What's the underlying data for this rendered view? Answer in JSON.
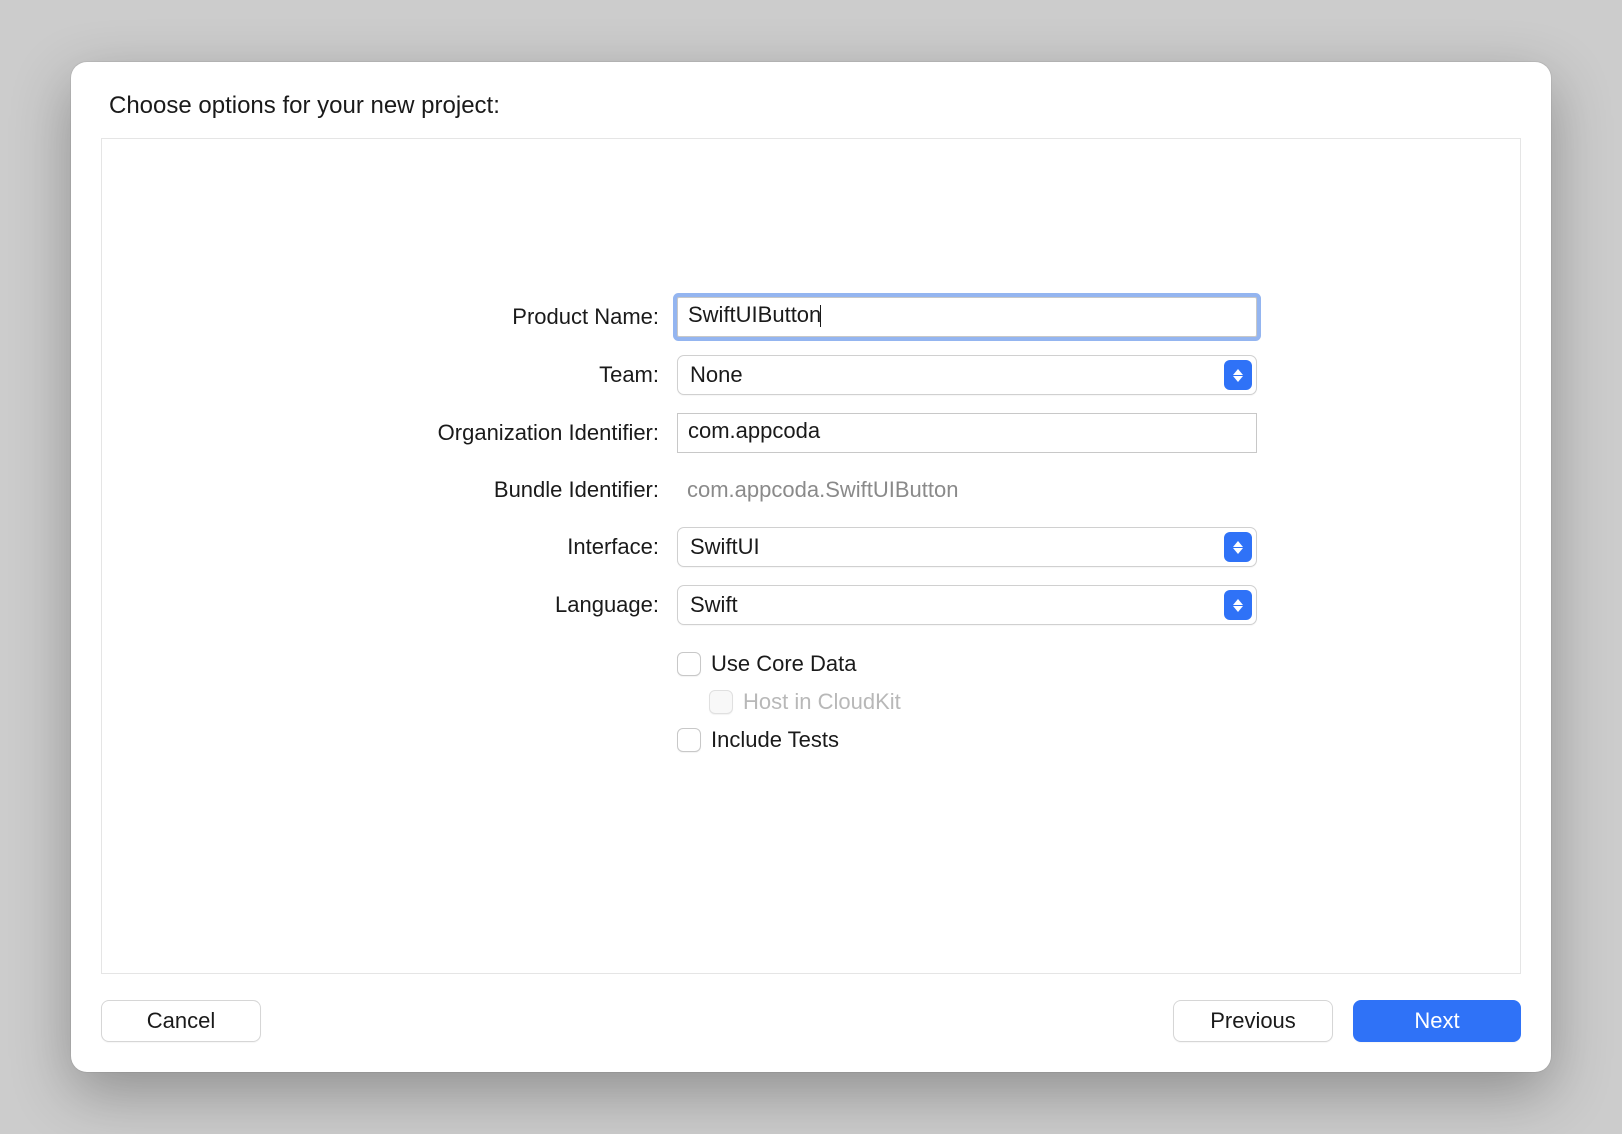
{
  "header": {
    "title": "Choose options for your new project:"
  },
  "form": {
    "productName": {
      "label": "Product Name:",
      "value": "SwiftUIButton"
    },
    "team": {
      "label": "Team:",
      "value": "None"
    },
    "orgIdentifier": {
      "label": "Organization Identifier:",
      "value": "com.appcoda"
    },
    "bundleIdentifier": {
      "label": "Bundle Identifier:",
      "value": "com.appcoda.SwiftUIButton"
    },
    "interface": {
      "label": "Interface:",
      "value": "SwiftUI"
    },
    "language": {
      "label": "Language:",
      "value": "Swift"
    },
    "useCoreData": {
      "label": "Use Core Data"
    },
    "hostCloudKit": {
      "label": "Host in CloudKit"
    },
    "includeTests": {
      "label": "Include Tests"
    }
  },
  "footer": {
    "cancel": "Cancel",
    "previous": "Previous",
    "next": "Next"
  }
}
